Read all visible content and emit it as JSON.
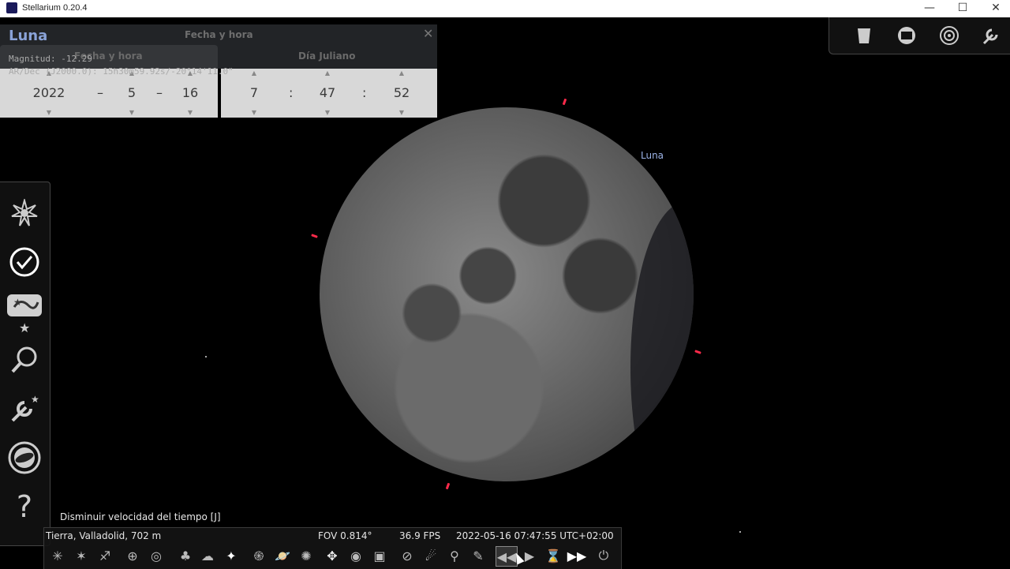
{
  "window": {
    "title": "Stellarium 0.20.4",
    "min": "—",
    "max": "☐",
    "close": "✕"
  },
  "object": {
    "name": "Luna",
    "magnitude": "Magnitud: -12.29",
    "radec": "AR/Dec (J2000.0): 15h30m59.92s/-20°14'11.0\""
  },
  "datetime_panel": {
    "title": "Fecha y hora",
    "tab_date": "Fecha y hora",
    "tab_julian": "Día Juliano",
    "year": "2022",
    "month": "5",
    "day": "16",
    "hour": "7",
    "minute": "47",
    "second": "52",
    "date_sep": "–",
    "time_sep": ":"
  },
  "sky_label": "Luna",
  "tooltip": "Disminuir velocidad del tiempo  [J]",
  "status": {
    "location": "Tierra, Valladolid, 702 m",
    "fov": "FOV 0.814°",
    "fps": "36.9 FPS",
    "datetime": "2022-05-16 07:47:55 UTC+02:00"
  },
  "left_toolbar": [
    "location-icon",
    "clock-icon",
    "sky-settings-icon",
    "search-icon",
    "config-icon",
    "astro-calc-icon",
    "help-icon"
  ],
  "left_help": "?",
  "top_toolbar": [
    "bucket-icon",
    "screen-icon",
    "target-icon",
    "wrench-icon"
  ],
  "bottom_toolbar": [
    "constellation-lines-icon",
    "constellation-labels-icon",
    "constellation-art-icon",
    "equatorial-grid-icon",
    "azimuthal-grid-icon",
    "ground-icon",
    "atmosphere-icon",
    "cardinal-points-icon",
    "deep-sky-icon",
    "planet-labels-icon",
    "exoplanets-icon",
    "fullscreen-icon",
    "night-mode-icon",
    "center-icon",
    "ecliptic-icon",
    "meteor-icon",
    "satellites-icon",
    "zoom-icon",
    "decrease-speed-icon",
    "normal-speed-icon",
    "set-time-now-icon",
    "increase-speed-icon",
    "quit-icon"
  ]
}
